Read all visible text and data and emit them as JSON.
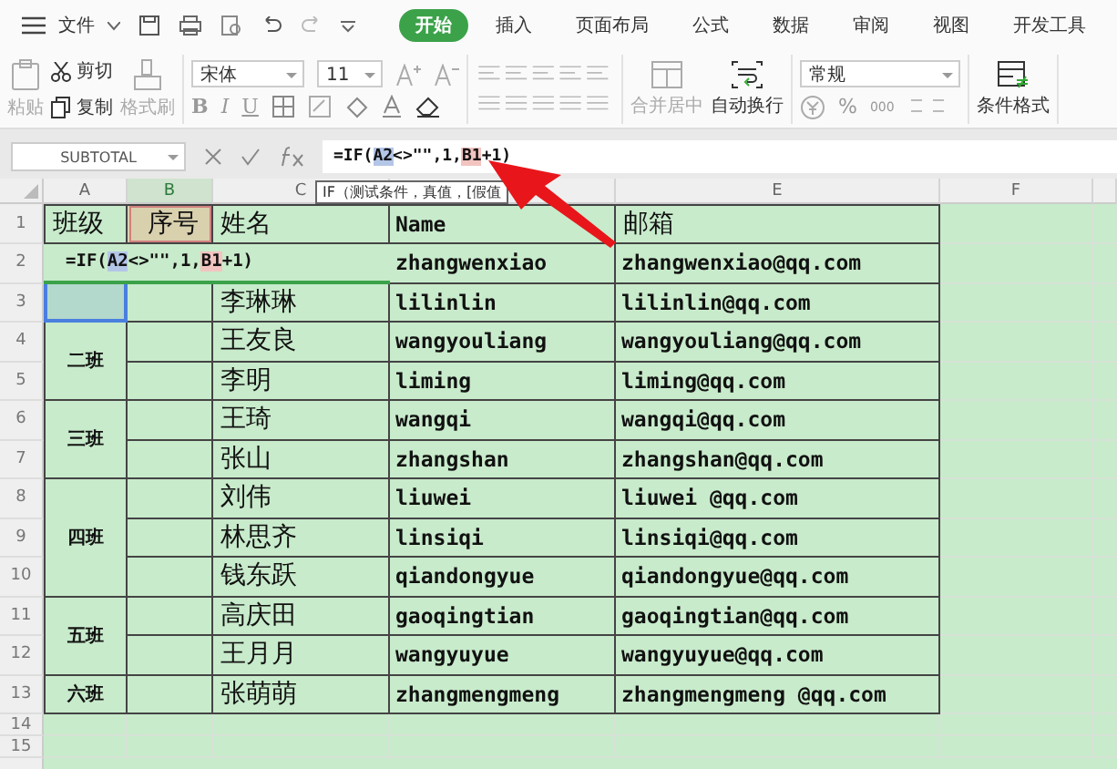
{
  "menu": {
    "file": "文件",
    "tabs": [
      {
        "label": "开始",
        "selected": true
      },
      {
        "label": "插入",
        "selected": false
      },
      {
        "label": "页面布局",
        "selected": false
      },
      {
        "label": "公式",
        "selected": false
      },
      {
        "label": "数据",
        "selected": false
      },
      {
        "label": "审阅",
        "selected": false
      },
      {
        "label": "视图",
        "selected": false
      },
      {
        "label": "开发工具",
        "selected": false
      }
    ]
  },
  "ribbon": {
    "paste": {
      "label": "粘贴",
      "disabled": true
    },
    "cut": {
      "label": "剪切",
      "disabled": false
    },
    "copy": {
      "label": "复制",
      "disabled": false
    },
    "format_painter": {
      "label": "格式刷",
      "disabled": true
    },
    "font": "宋体",
    "font_size": "11",
    "font_styles": [
      "B",
      "I",
      "U"
    ],
    "merge": {
      "label": "合并居中",
      "disabled": true
    },
    "wrap": {
      "label": "自动换行",
      "disabled": false
    },
    "number_format": "常规",
    "percent": "%",
    "thousands": "000",
    "conditional": "条件格式"
  },
  "formula_bar": {
    "name_box": "SUBTOTAL",
    "parts": [
      {
        "text": "=IF(",
        "kind": "plain"
      },
      {
        "text": "A2",
        "kind": "ref",
        "color": "#b4c6e7"
      },
      {
        "text": "<>\"\",1,",
        "kind": "plain"
      },
      {
        "text": "B1",
        "kind": "ref",
        "color": "#f2c4c0"
      },
      {
        "text": "+1)",
        "kind": "plain"
      }
    ],
    "tooltip": "IF（测试条件，真值，[假值"
  },
  "columns": [
    {
      "label": "A",
      "selected": false
    },
    {
      "label": "B",
      "selected": true
    },
    {
      "label": "C",
      "selected": false
    },
    {
      "selected": false
    },
    {
      "label": "E",
      "selected": false
    },
    {
      "label": "F",
      "selected": false
    }
  ],
  "row_numbers": [
    "1",
    "2",
    "3",
    "4",
    "5",
    "6",
    "7",
    "8",
    "9",
    "10",
    "11",
    "12",
    "13",
    "14",
    "15"
  ],
  "header": {
    "class": "班级",
    "seq": "序号",
    "name": "姓名",
    "pinyin": "Name",
    "email": "邮箱"
  },
  "cell_editor": {
    "parts": [
      {
        "text": "=IF(",
        "kind": "plain"
      },
      {
        "text": "A2",
        "kind": "ref",
        "color": "#b4c6e7"
      },
      {
        "text": "<>\"\",1,",
        "kind": "plain"
      },
      {
        "text": "B1",
        "kind": "ref",
        "color": "#f2c4c0"
      },
      {
        "text": "+1)",
        "kind": "plain"
      }
    ]
  },
  "groups": [
    {
      "selected": true,
      "members": [
        {
          "pinyin": "zhangwenxiao",
          "email": "zhangwenxiao@qq.com"
        },
        {
          "name": "李琳琳",
          "pinyin": "lilinlin",
          "email": "lilinlin@qq.com"
        }
      ]
    },
    {
      "label": "二班",
      "selected": false,
      "members": [
        {
          "name": "王友良",
          "pinyin": "wangyouliang",
          "email": "wangyouliang@qq.com"
        },
        {
          "name": "李明",
          "pinyin": "liming",
          "email": "liming@qq.com"
        }
      ]
    },
    {
      "label": "三班",
      "selected": false,
      "members": [
        {
          "name": "王琦",
          "pinyin": "wangqi",
          "email": "wangqi@qq.com"
        },
        {
          "name": "张山",
          "pinyin": "zhangshan",
          "email": "zhangshan@qq.com"
        }
      ]
    },
    {
      "label": "四班",
      "selected": false,
      "members": [
        {
          "name": "刘伟",
          "pinyin": "liuwei",
          "email": "liuwei @qq.com"
        },
        {
          "name": "林思齐",
          "pinyin": "linsiqi",
          "email": "linsiqi@qq.com"
        },
        {
          "name": "钱东跃",
          "pinyin": "qiandongyue",
          "email": "qiandongyue@qq.com"
        }
      ]
    },
    {
      "label": "五班",
      "selected": false,
      "members": [
        {
          "name": "高庆田",
          "pinyin": "gaoqingtian",
          "email": "gaoqingtian@qq.com"
        },
        {
          "name": "王月月",
          "pinyin": "wangyuyue",
          "email": "wangyuyue@qq.com"
        }
      ]
    },
    {
      "label": "六班",
      "selected": false,
      "members": [
        {
          "name": "张萌萌",
          "pinyin": "zhangmengmeng",
          "email": "zhangmengmeng @qq.com"
        }
      ]
    }
  ]
}
